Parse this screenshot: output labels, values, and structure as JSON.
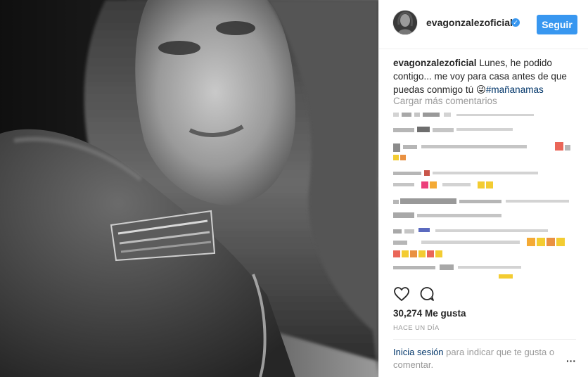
{
  "post": {
    "username": "evagonzalezoficial",
    "follow_label": "Seguir",
    "caption": {
      "text": "Lunes, he podido contigo... me voy para casa antes de que puedas conmigo tú 😜",
      "hashtag": "#mañanamas"
    },
    "load_more_label": "Cargar más comentarios",
    "likes": "30,274 Me gusta",
    "timestamp": "HACE UN DÍA",
    "login_prompt": {
      "link": "Inicia sesión",
      "rest": " para indicar que te gusta o comentar."
    },
    "more_label": "···"
  },
  "icons": {
    "verified": "verified-badge-icon",
    "like": "heart-icon",
    "comment": "comment-bubble-icon",
    "more": "more-options-icon"
  },
  "colors": {
    "accent": "#3897f0",
    "link": "#003569",
    "muted": "#999999",
    "text": "#262626",
    "border": "#efefef"
  }
}
